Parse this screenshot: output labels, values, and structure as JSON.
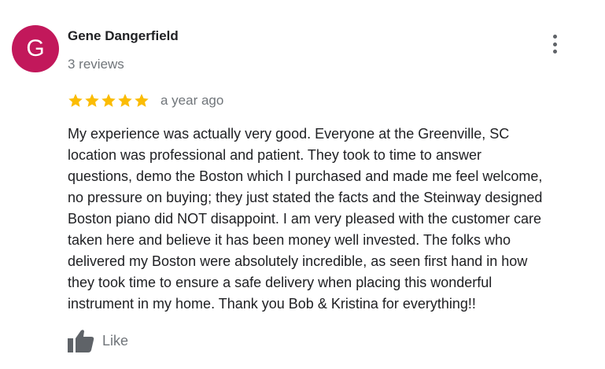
{
  "reviewer": {
    "avatar_initial": "G",
    "avatar_color": "#c2185b",
    "name": "Gene Dangerfield",
    "review_count": "3 reviews"
  },
  "review": {
    "rating": 5,
    "max_rating": 5,
    "star_color": "#fbbc04",
    "date": "a year ago",
    "text": "My experience was actually very good.    Everyone at the Greenville, SC\nlocation was professional and patient.  They took to time to answer\nquestions, demo the Boston which I purchased and made me feel welcome,\nno pressure on buying; they just stated the facts and the Steinway designed\nBoston piano did NOT disappoint.  I am very pleased with the customer care\ntaken here and believe it has been money well invested.  The folks who\ndelivered my Boston were absolutely incredible, as seen first hand in how\nthey took time to ensure a safe delivery when placing this wonderful\ninstrument in my home.  Thank you Bob & Kristina for everything!!"
  },
  "actions": {
    "like_label": "Like",
    "more_icon": "more-vert-icon",
    "like_icon": "thumb-up-icon"
  }
}
